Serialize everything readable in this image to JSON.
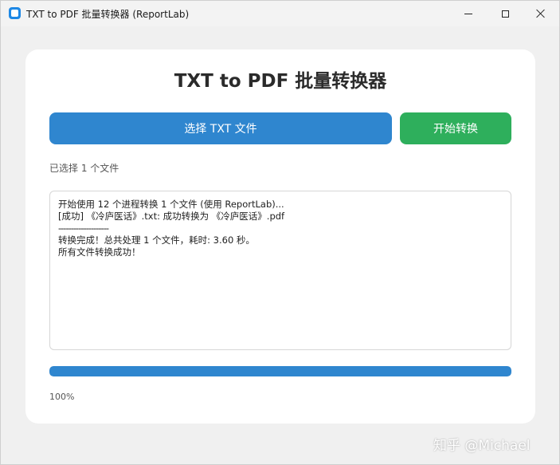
{
  "window": {
    "title": "TXT to PDF 批量转换器 (ReportLab)"
  },
  "main": {
    "title": "TXT to PDF 批量转换器",
    "select_button_label": "选择 TXT 文件",
    "start_button_label": "开始转换",
    "selected_info": "已选择 1 个文件",
    "log_lines": [
      "开始使用 12 个进程转换 1 个文件 (使用 ReportLab)...",
      "[成功] 《冷庐医话》.txt: 成功转换为 《冷庐医话》.pdf",
      "--------------------",
      "转换完成！总共处理 1 个文件，耗时: 3.60 秒。",
      "所有文件转换成功！"
    ],
    "progress_percent": 100,
    "progress_label": "100%"
  },
  "colors": {
    "select_button": "#2f86cf",
    "start_button": "#2eaf5c",
    "progress_fill": "#2f86cf"
  },
  "watermark": "知乎 @Michael"
}
